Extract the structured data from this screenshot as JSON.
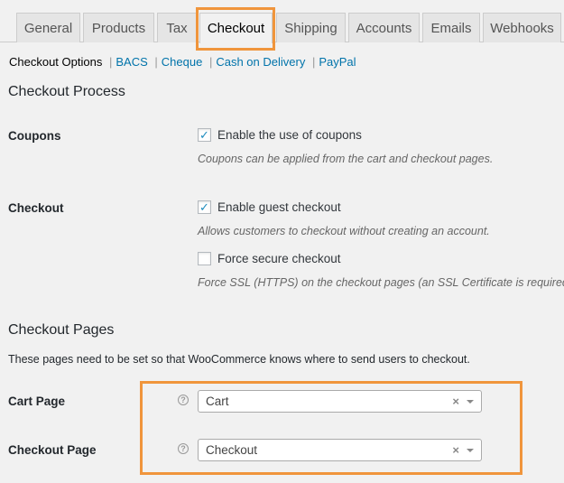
{
  "tabs": [
    {
      "label": "General"
    },
    {
      "label": "Products"
    },
    {
      "label": "Tax"
    },
    {
      "label": "Checkout"
    },
    {
      "label": "Shipping"
    },
    {
      "label": "Accounts"
    },
    {
      "label": "Emails"
    },
    {
      "label": "Webhooks"
    }
  ],
  "active_tab": "Checkout",
  "subnav": {
    "current": "Checkout Options",
    "links": [
      "BACS",
      "Cheque",
      "Cash on Delivery",
      "PayPal"
    ],
    "separator": "|"
  },
  "checkout_process": {
    "heading": "Checkout Process",
    "coupons": {
      "label": "Coupons",
      "checkbox_label": "Enable the use of coupons",
      "checked": true,
      "description": "Coupons can be applied from the cart and checkout pages."
    },
    "checkout": {
      "label": "Checkout",
      "guest_label": "Enable guest checkout",
      "guest_checked": true,
      "guest_description": "Allows customers to checkout without creating an account.",
      "secure_label": "Force secure checkout",
      "secure_checked": false,
      "secure_description": "Force SSL (HTTPS) on the checkout pages (an SSL Certificate is required)."
    }
  },
  "checkout_pages": {
    "heading": "Checkout Pages",
    "intro": "These pages need to be set so that WooCommerce knows where to send users to checkout.",
    "cart_page": {
      "label": "Cart Page",
      "value": "Cart"
    },
    "checkout_page": {
      "label": "Checkout Page",
      "value": "Checkout"
    },
    "help_glyph": "?",
    "clear_glyph": "×",
    "check_glyph": "✓"
  },
  "colors": {
    "highlight": "#f0953c",
    "link": "#0073aa",
    "checkmark": "#1e8cbe"
  }
}
